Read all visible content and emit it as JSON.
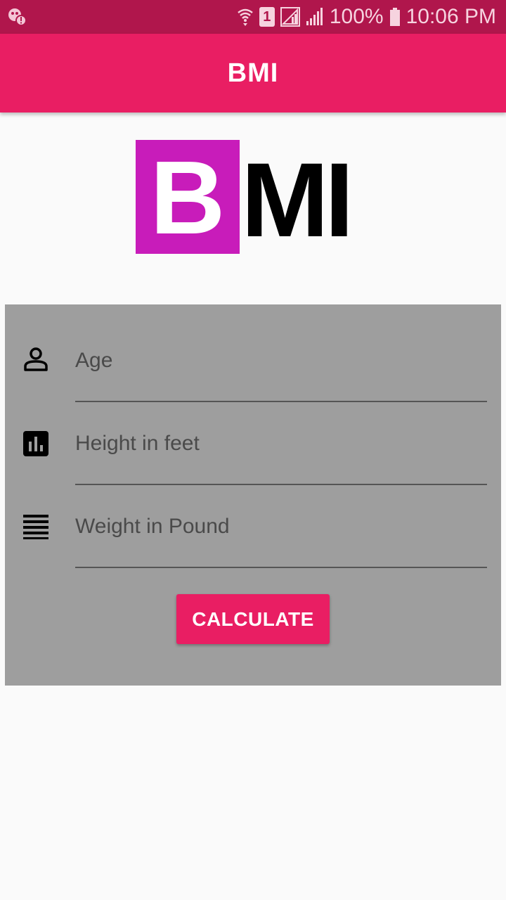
{
  "status_bar": {
    "battery": "100%",
    "time": "10:06 PM",
    "sim_badge": "1",
    "icons": [
      "notification-alert-icon",
      "wifi-icon",
      "sim-icon",
      "signal-icon",
      "signal-icon",
      "battery-icon"
    ]
  },
  "app_bar": {
    "title": "BMI"
  },
  "logo": {
    "letter_box": "B",
    "letters": "MI",
    "box_color": "#c81cba"
  },
  "form": {
    "fields": [
      {
        "placeholder": "Age",
        "value": "",
        "icon": "person-icon"
      },
      {
        "placeholder": "Height in feet",
        "value": "",
        "icon": "bar-chart-icon"
      },
      {
        "placeholder": "Weight in Pound",
        "value": "",
        "icon": "lines-icon"
      }
    ],
    "button_label": "CALCULATE"
  },
  "colors": {
    "accent": "#e91e63",
    "status_bar": "#b0164c",
    "card": "#9e9e9e",
    "background": "#fafafa"
  }
}
